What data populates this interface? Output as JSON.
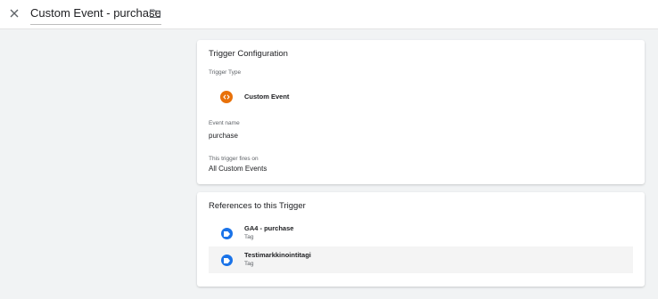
{
  "header": {
    "title": "Custom Event - purchase",
    "close_icon": "close-icon",
    "folder_icon": "folder-icon"
  },
  "trigger_config": {
    "heading": "Trigger Configuration",
    "type_label": "Trigger Type",
    "type_name": "Custom Event",
    "type_icon": "custom-event-icon",
    "type_icon_color": "#e8710a",
    "event_name_label": "Event name",
    "event_name_value": "purchase",
    "fires_on_label": "This trigger fires on",
    "fires_on_value": "All Custom Events"
  },
  "references": {
    "heading": "References to this Trigger",
    "tag_icon_color": "#1a73e8",
    "items": [
      {
        "name": "GA4 - purchase",
        "kind": "Tag",
        "icon": "tag-icon"
      },
      {
        "name": "Testimarkkinointitagi",
        "kind": "Tag",
        "icon": "tag-icon"
      }
    ]
  }
}
